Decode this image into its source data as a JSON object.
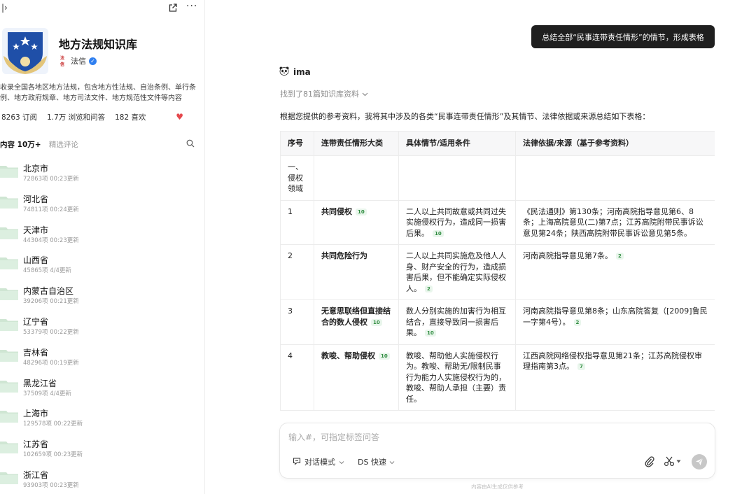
{
  "colors": {
    "user_bubble": "#1f1f1f",
    "cite_bg": "#e9f6ec",
    "cite_fg": "#2e8b3e",
    "heart": "#e5484d",
    "verify": "#2f7ff0",
    "folder": "#cfe6d3"
  },
  "sidebar": {
    "expand_icon": "sidebar-expand-icon",
    "share_icon": "share-icon",
    "more_icon": "more-icon",
    "more_glyph": "···",
    "kb": {
      "title": "地方法规知识库",
      "source_logo": "法信",
      "source_name": "法信",
      "description": "收录全国各地区地方法规，包含地方性法规、自治条例、单行条例、地方政府规章、地方司法文件、地方规范性文件等内容",
      "stats": {
        "subs": "8263 订阅",
        "views": "1.7万 浏览和问答",
        "likes": "182 喜欢"
      }
    },
    "tabs": {
      "content": "内容 10万+",
      "comments": "精选评论"
    },
    "folders": [
      {
        "name": "北京市",
        "meta": "72863项   00:23更新"
      },
      {
        "name": "河北省",
        "meta": "74811项   00:24更新"
      },
      {
        "name": "天津市",
        "meta": "44304项   00:23更新"
      },
      {
        "name": "山西省",
        "meta": "45865项   4/4更新"
      },
      {
        "name": "内蒙古自治区",
        "meta": "39206项   00:21更新"
      },
      {
        "name": "辽宁省",
        "meta": "53379项   00:22更新"
      },
      {
        "name": "吉林省",
        "meta": "48296项   00:19更新"
      },
      {
        "name": "黑龙江省",
        "meta": "37509项   4/4更新"
      },
      {
        "name": "上海市",
        "meta": "129578项   00:22更新"
      },
      {
        "name": "江苏省",
        "meta": "102659项   00:23更新"
      },
      {
        "name": "浙江省",
        "meta": "93903项   00:23更新"
      }
    ]
  },
  "chat": {
    "user_message": "总结全部“民事连带责任情形”的情节，形成表格",
    "bot_name": "ima",
    "found": "找到了81篇知识库资料",
    "intro": "根据您提供的参考资料，我将其中涉及的各类“民事连带责任情形”及其情节、法律依据或来源总结如下表格：",
    "table": {
      "headers": [
        "序号",
        "连带责任情形大类",
        "具体情节/适用条件",
        "法律依据/来源（基于参考资料）"
      ],
      "rows": [
        {
          "no": "一、侵权领域",
          "category": "",
          "cat_cite": "",
          "detail": "",
          "detail_cite": "",
          "basis": "",
          "basis_cite": ""
        },
        {
          "no": "1",
          "category": "共同侵权",
          "cat_cite": "10",
          "detail": "二人以上共同故意或共同过失实施侵权行为，造成同一损害后果。",
          "detail_cite": "10",
          "basis": "《民法通则》第130条；河南高院指导意见第6、8条；上海高院意见(二)第7点；江苏高院附带民事诉讼意见第24条；陕西高院附带民事诉讼意见第5条。",
          "basis_cite": ""
        },
        {
          "no": "2",
          "category": "共同危险行为",
          "cat_cite": "",
          "detail": "二人以上共同实施危及他人人身、财产安全的行为，造成损害后果，但不能确定实际侵权人。",
          "detail_cite": "2",
          "basis": "河南高院指导意见第7条。",
          "basis_cite": "2"
        },
        {
          "no": "3",
          "category": "无意思联络但直接结合的数人侵权",
          "cat_cite": "10",
          "detail": "数人分别实施的加害行为相互结合，直接导致同一损害后果。",
          "detail_cite": "10",
          "basis": "河南高院指导意见第8条；山东高院答复（[2009]鲁民一字第4号）。",
          "basis_cite": "2"
        },
        {
          "no": "4",
          "category": "教唆、帮助侵权",
          "cat_cite": "10",
          "detail": "教唆、帮助他人实施侵权行为。教唆、帮助无/限制民事行为能力人实施侵权行为的，教唆、帮助人承担（主要）责任。",
          "detail_cite": "",
          "basis": "江西高院网络侵权指导意见第21条；江苏高院侵权审理指南第3点。",
          "basis_cite": "7"
        }
      ]
    }
  },
  "composer": {
    "placeholder": "输入#，可指定标签问答",
    "mode": "对话模式",
    "model": "DS 快速",
    "footnote": "内容由AI生成仅供参考"
  }
}
